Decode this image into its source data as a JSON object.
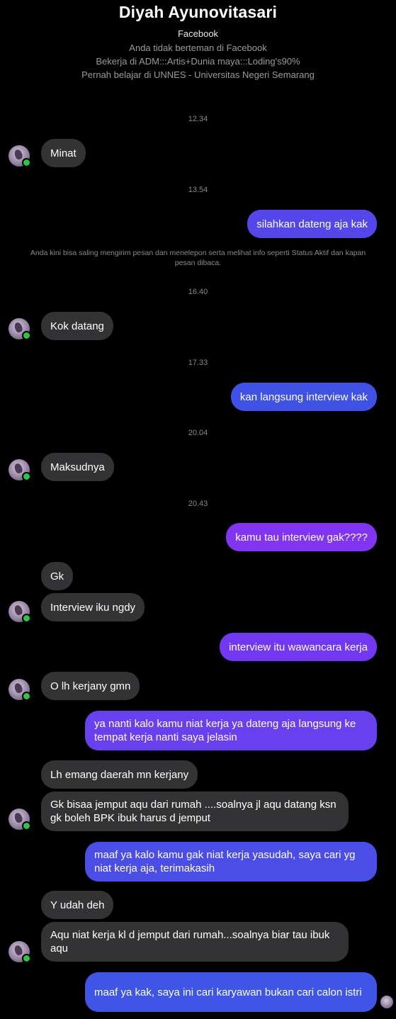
{
  "header": {
    "name": "Diyah Ayunovitasari",
    "platform": "Facebook",
    "not_friends": "Anda tidak berteman di Facebook",
    "work": "Bekerja di ADM:::Artis+Dunia maya:::Loding's90%",
    "education": "Pernah belajar di UNNES - Universitas Negeri Semarang"
  },
  "colors": {
    "incoming": "#333336",
    "outgoing_blue": "#3f4fe0",
    "outgoing_purple": "#7a3cf0",
    "online": "#31c24a"
  },
  "timestamps": [
    "12.34",
    "13.54",
    "16.40",
    "17.33",
    "20.04",
    "20.43"
  ],
  "notice": "Anda kini bisa saling mengirim pesan dan menelepon serta melihat info seperti Status Aktif dan kapan pesan dibaca.",
  "messages": [
    "Minat",
    "silahkan dateng aja kak",
    "Kok datang",
    "kan langsung interview kak",
    "Maksudnya",
    "kamu tau interview gak????",
    "Gk",
    "Interview iku ngdy",
    "interview itu wawancara kerja",
    "O lh kerjany gmn",
    "ya nanti kalo kamu niat kerja ya dateng aja langsung ke tempat kerja nanti saya jelasin",
    "Lh emang daerah mn kerjany",
    "Gk bisaa jemput aqu dari rumah ....soalnya jl aqu datang ksn gk boleh BPK ibuk harus d jemput",
    "maaf ya kalo kamu gak niat kerja yasudah, saya cari yg niat kerja aja, terimakasih",
    "Y udah deh",
    "Aqu niat kerja kl d jemput dari rumah...soalnya biar tau ibuk aqu",
    "maaf ya kak, saya ini cari karyawan bukan cari calon istri"
  ]
}
